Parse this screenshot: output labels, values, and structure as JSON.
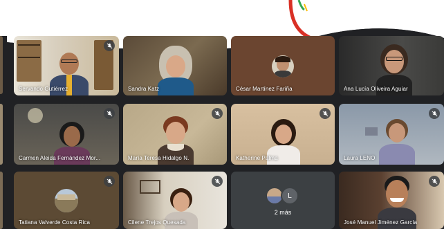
{
  "participants": [
    {
      "name": "Servando Gutiérrez",
      "muted": true
    },
    {
      "name": "Sandra Katz",
      "muted": false
    },
    {
      "name": "César Martínez Fariña",
      "muted": false
    },
    {
      "name": "Ana Lucía Oliveira Aguiar",
      "muted": false
    },
    {
      "name": "Carmen Aleida Fernández Mor...",
      "muted": true
    },
    {
      "name": "María Teresa Hidalgo N.",
      "muted": true
    },
    {
      "name": "Katherine Palma",
      "muted": true
    },
    {
      "name": "Laura LENO",
      "muted": true
    },
    {
      "name": "Tatiana Valverde Costa Rica",
      "muted": true
    },
    {
      "name": "Cilene Trejos Quesada",
      "muted": true
    },
    {
      "name": "José Manuel Jiménez García",
      "muted": true
    }
  ],
  "overflow": {
    "label": "2 más",
    "avatar_letter": "L"
  },
  "colors": {
    "meet_dark": "#202124",
    "tile_grey": "#3c4043",
    "accent_red": "#d93025",
    "accent_green": "#34a853",
    "accent_yellow": "#fbbc04"
  },
  "icons": {
    "mute": "mic-off-icon"
  }
}
